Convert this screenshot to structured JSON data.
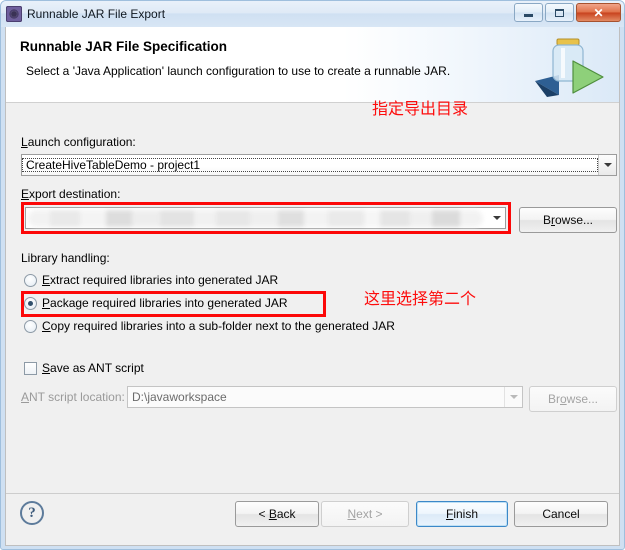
{
  "window": {
    "title": "Runnable JAR File Export",
    "icon": "jar-export-icon",
    "buttons": {
      "minimize": "minimize-icon",
      "maximize": "maximize-icon",
      "close": "✕"
    }
  },
  "banner": {
    "title": "Runnable JAR File Specification",
    "description": "Select a 'Java Application' launch configuration to use to create a runnable JAR.",
    "art": "jar-with-green-arrow-icon"
  },
  "form": {
    "launch_configuration": {
      "label": "Launch configuration:",
      "mnemonic": "L",
      "value": "CreateHiveTableDemo - project1"
    },
    "export_destination": {
      "label": "Export destination:",
      "mnemonic": "E",
      "value": "",
      "redacted": true,
      "browse_label": "Browse...",
      "browse_mnemonic": "r"
    },
    "library_handling": {
      "label": "Library handling:",
      "options": [
        {
          "label": "Extract required libraries into generated JAR",
          "mnemonic": "E",
          "selected": false
        },
        {
          "label": "Package required libraries into generated JAR",
          "mnemonic": "P",
          "selected": true
        },
        {
          "label": "Copy required libraries into a sub-folder next to the generated JAR",
          "mnemonic": "C",
          "selected": false
        }
      ]
    },
    "save_ant_script": {
      "label": "Save as ANT script",
      "mnemonic": "S",
      "checked": false
    },
    "ant_script_location": {
      "label": "ANT script location:",
      "mnemonic": "A",
      "value": "D:\\javaworkspace",
      "disabled": true,
      "browse_label": "Browse...",
      "browse_mnemonic": "o"
    }
  },
  "annotations": [
    {
      "text": "指定导出目录",
      "target": "export-destination"
    },
    {
      "text": "这里选择第二个",
      "target": "library-handling-option-2"
    }
  ],
  "footer": {
    "help": "?",
    "back": "< Back",
    "back_mnemonic": "B",
    "next": "Next >",
    "next_mnemonic": "N",
    "next_disabled": true,
    "finish": "Finish",
    "finish_mnemonic": "F",
    "finish_default": true,
    "cancel": "Cancel"
  },
  "colors": {
    "annotation_red": "#fd0d0d",
    "window_frame": "#cfe0f2",
    "client_bg": "#f0f0f0",
    "default_button_border": "#3c88c8"
  }
}
